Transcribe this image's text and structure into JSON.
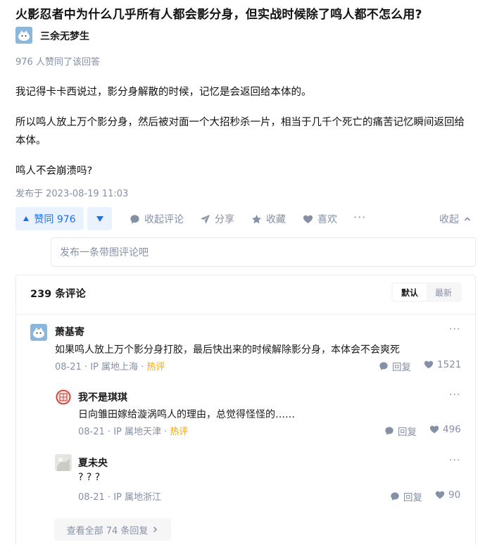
{
  "question": {
    "title": "火影忍者中为什么几乎所有人都会影分身，但实战时候除了鸣人都不怎么用?"
  },
  "author": {
    "name": "三余无梦生"
  },
  "answer": {
    "agree_text": "976 人赞同了该回答",
    "paragraphs": [
      "我记得卡卡西说过，影分身解散的时候，记忆是会返回给本体的。",
      "所以鸣人放上万个影分身，然后被对面一个大招秒杀一片，相当于几千个死亡的痛苦记忆瞬间返回给本体。",
      "鸣人不会崩溃吗?"
    ],
    "published": "发布于 2023-08-19 11:03"
  },
  "actions": {
    "vote_up": "赞同 976",
    "collapse_comments": "收起评论",
    "share": "分享",
    "favorite": "收藏",
    "like": "喜欢",
    "more": "···",
    "collapse": "收起"
  },
  "comment_input": {
    "placeholder": "发布一条带图评论吧"
  },
  "comments": {
    "count_title": "239 条评论",
    "sort_default": "默认",
    "sort_latest": "最新",
    "items": [
      {
        "name": "萧基寄",
        "text": "如果鸣人放上万个影分身打胶，最后快出来的时候解除影分身，本体会不会爽死",
        "date": "08-21",
        "ip": "IP 属地上海",
        "hot": "热评",
        "reply": "回复",
        "likes": "1521",
        "more": "···"
      },
      {
        "name": "我不是琪琪",
        "text": "日向雏田嫁给漩涡鸣人的理由，总觉得怪怪的……",
        "date": "08-21",
        "ip": "IP 属地天津",
        "hot": "热评",
        "reply": "回复",
        "likes": "496",
        "more": "···"
      },
      {
        "name": "夏未央",
        "text": "? ? ?",
        "date": "08-21",
        "ip": "IP 属地浙江",
        "reply": "回复",
        "likes": "90",
        "more": "···"
      }
    ],
    "view_all": "查看全部 74 条回复"
  },
  "colors": {
    "brand_blue": "#1772f6",
    "vote_bg": "#eaf2fe",
    "hot": "#f1a60f",
    "meta_gray": "#8590a6"
  },
  "icons": [
    "author-avatar",
    "comment-bubble-icon",
    "paper-plane-icon",
    "star-icon",
    "heart-icon",
    "chevron-up-icon",
    "chevron-right-icon"
  ]
}
